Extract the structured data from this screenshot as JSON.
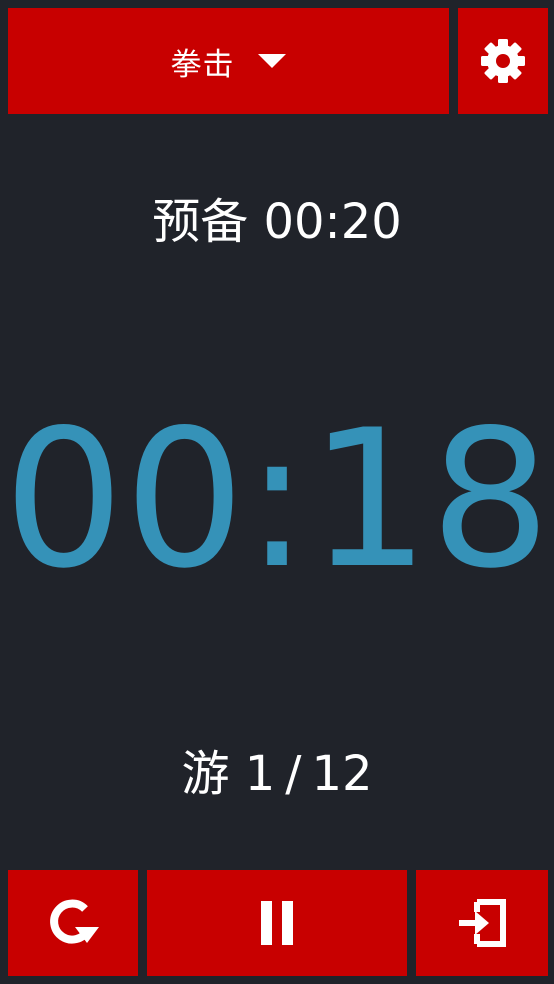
{
  "theme": {
    "background": "#20232a",
    "button_color": "#c80000",
    "timer_color": "#3592b8",
    "text_color": "#ffffff"
  },
  "header": {
    "mode_label": "拳击",
    "mode_dropdown_icon": "triangle-down-icon",
    "settings_icon": "gear-icon"
  },
  "prep": {
    "label": "预备",
    "time": "00:20"
  },
  "timer": {
    "display": "00:18"
  },
  "round": {
    "label": "游",
    "current": "1",
    "separator": "/",
    "total": "12"
  },
  "controls": {
    "reset_icon": "reset-icon",
    "pause_icon": "pause-icon",
    "exit_icon": "exit-icon"
  }
}
